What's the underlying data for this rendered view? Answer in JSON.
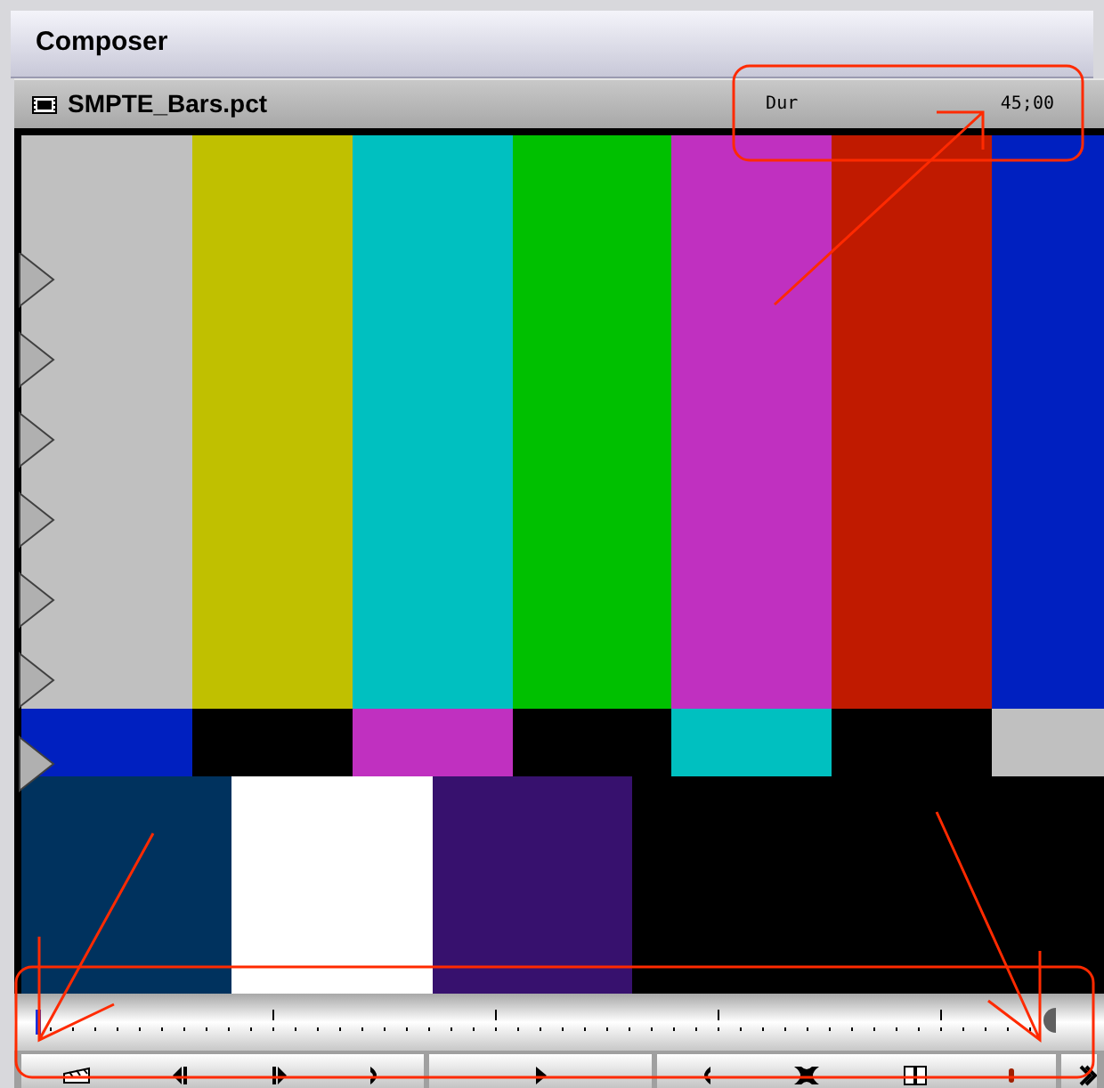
{
  "window": {
    "title": "Composer"
  },
  "clip": {
    "name": "SMPTE_Bars.pct",
    "duration_label": "Dur",
    "duration": "45;00"
  }
}
